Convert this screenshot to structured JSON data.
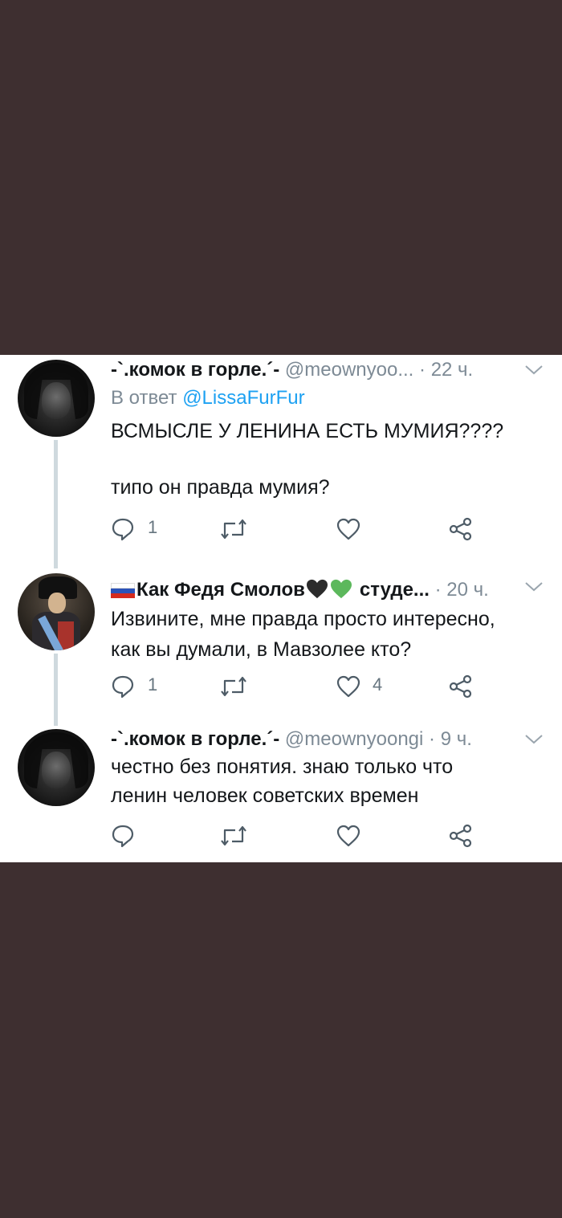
{
  "tweets": [
    {
      "name": "-`.комок в горле.´-",
      "handle": "@meownyoo...",
      "dot": "·",
      "time": "22 ч.",
      "reply_prefix": "В ответ",
      "reply_mention": "@LissaFurFur",
      "lines": [
        "ВСМЫСЛЕ У ЛЕНИНА ЕСТЬ МУМИЯ????",
        "",
        "типо он правда мумия?"
      ],
      "reply_count": "1",
      "like_count": ""
    },
    {
      "name": "Как Федя Смолов",
      "name_tail": "студе...",
      "handle": "",
      "dot": "·",
      "time": "20 ч.",
      "lines": [
        "Извините, мне правда просто интересно,",
        "как вы думали, в Мавзолее кто?"
      ],
      "reply_count": "1",
      "like_count": "4",
      "flag_colors": [
        "#ffffff",
        "#2b53b8",
        "#d52b1e"
      ],
      "heart_colors": [
        "#2b2b2b",
        "#5cb85c"
      ]
    },
    {
      "name": "-`.комок в горле.´-",
      "handle": "@meownyoongi",
      "dot": "·",
      "time": "9 ч.",
      "lines": [
        "честно без понятия. знаю только что",
        "ленин человек советских времен"
      ],
      "reply_count": "",
      "like_count": ""
    }
  ],
  "icons": [
    "reply-icon",
    "retweet-icon",
    "like-icon",
    "share-icon",
    "chevron-down-icon"
  ],
  "colors": {
    "background": "#3e2f30",
    "card": "#ffffff",
    "muted": "#7d8a95",
    "link": "#1da1f2"
  }
}
